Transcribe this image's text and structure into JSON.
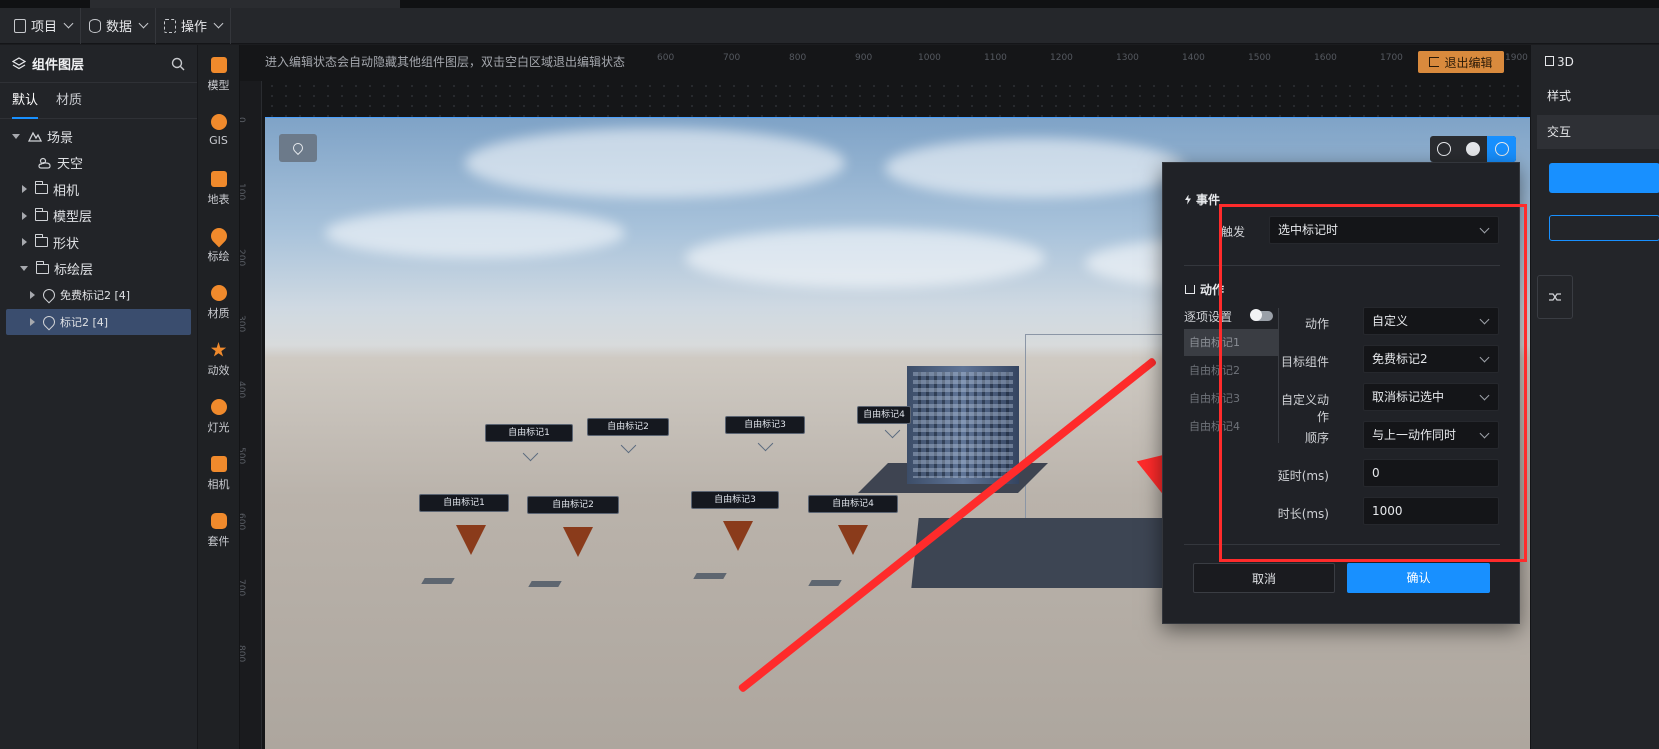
{
  "menubar": {
    "items": [
      {
        "label": "项目",
        "icon": "document-icon"
      },
      {
        "label": "数据",
        "icon": "database-icon"
      },
      {
        "label": "操作",
        "icon": "grid-icon"
      }
    ]
  },
  "layers": {
    "title": "组件图层",
    "tabs": [
      "默认",
      "材质"
    ],
    "tree": [
      {
        "label": "场景",
        "level": 0,
        "caret": "down",
        "icon": "scene-icon"
      },
      {
        "label": "天空",
        "level": 1,
        "caret": "none",
        "icon": "weather-icon"
      },
      {
        "label": "相机",
        "level": 1,
        "caret": "right",
        "icon": "folder-icon"
      },
      {
        "label": "模型层",
        "level": 1,
        "caret": "right",
        "icon": "folder-icon"
      },
      {
        "label": "形状",
        "level": 1,
        "caret": "right",
        "icon": "folder-icon"
      },
      {
        "label": "标绘层",
        "level": 1,
        "caret": "down",
        "icon": "folder-icon"
      },
      {
        "label": "免费标记2 [4]",
        "level": 2,
        "caret": "right",
        "icon": "marker-icon"
      },
      {
        "label": "标记2 [4]",
        "level": 2,
        "caret": "right",
        "icon": "marker-icon",
        "selected": true
      }
    ]
  },
  "tools": [
    {
      "label": "模型",
      "icon": "model-icon"
    },
    {
      "label": "GIS",
      "icon": "gis-icon"
    },
    {
      "label": "地表",
      "icon": "terrain-icon"
    },
    {
      "label": "标绘",
      "icon": "plot-icon"
    },
    {
      "label": "材质",
      "icon": "material-icon"
    },
    {
      "label": "动效",
      "icon": "effect-icon"
    },
    {
      "label": "灯光",
      "icon": "light-icon"
    },
    {
      "label": "相机",
      "icon": "camera-icon"
    },
    {
      "label": "套件",
      "icon": "kit-icon"
    }
  ],
  "canvas": {
    "hint": "进入编辑状态会自动隐藏其他组件图层，双击空白区域退出编辑状态",
    "exit_label": "退出编辑",
    "ruler_top": [
      "600",
      "700",
      "800",
      "900",
      "1000",
      "1100",
      "1200",
      "1300",
      "1400",
      "1500",
      "1600",
      "1700",
      "1800",
      "1900"
    ],
    "ruler_left": [
      "0",
      "100",
      "200",
      "300",
      "400",
      "500",
      "600",
      "700",
      "800"
    ],
    "markers_upper": [
      "自由标记1",
      "自由标记2",
      "自由标记3",
      "自由标记4"
    ],
    "markers_lower": [
      "自由标记1",
      "自由标记2",
      "自由标记3",
      "自由标记4"
    ]
  },
  "dialog": {
    "event_title": "事件",
    "trigger_label": "触发",
    "trigger_value": "选中标记时",
    "action_title": "动作",
    "per_item_label": "逐项设置",
    "steps": [
      "自由标记1",
      "自由标记2",
      "自由标记3",
      "自由标记4"
    ],
    "fields": [
      {
        "label": "动作",
        "value": "自定义",
        "type": "select"
      },
      {
        "label": "目标组件",
        "value": "免费标记2",
        "type": "select"
      },
      {
        "label": "自定义动作",
        "value": "取消标记选中",
        "type": "select"
      },
      {
        "label": "顺序",
        "value": "与上一动作同时",
        "type": "select"
      },
      {
        "label": "延时(ms)",
        "value": "0",
        "type": "input"
      },
      {
        "label": "时长(ms)",
        "value": "1000",
        "type": "input"
      }
    ],
    "cancel_label": "取消",
    "ok_label": "确认"
  },
  "rightpanel": {
    "title": "3D",
    "tabs": [
      "样式",
      "交互"
    ]
  },
  "colors": {
    "accent": "#1890ff",
    "highlight": "#ff2b2b",
    "exit": "#d98a3d"
  }
}
